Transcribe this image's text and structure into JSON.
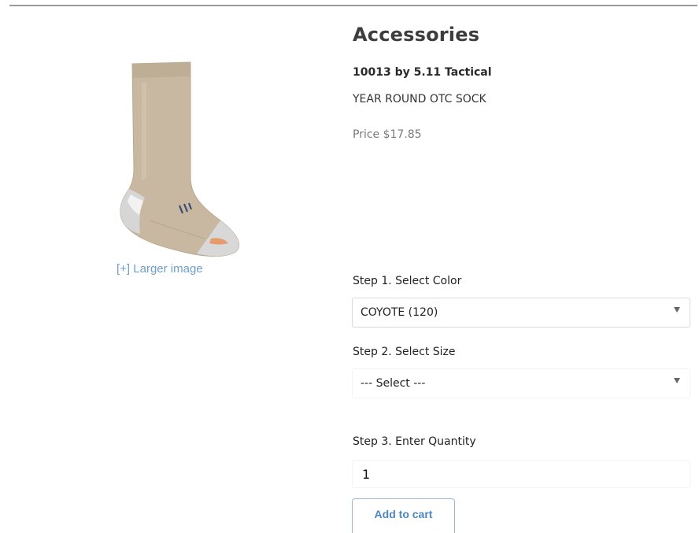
{
  "product": {
    "category_title": "Accessories",
    "brand_line": "10013 by 5.11 Tactical",
    "name": "YEAR ROUND OTC SOCK",
    "price": "Price $17.85",
    "larger_image_link": "[+] Larger image",
    "image_icon": "sock-product-image"
  },
  "options": {
    "step1_label": "Step 1. Select Color",
    "color_selected": "COYOTE (120)",
    "step2_label": "Step 2. Select Size",
    "size_selected": "--- Select ---",
    "step3_label": "Step 3. Enter Quantity",
    "quantity_value": "1"
  },
  "actions": {
    "add_to_cart_label": "Add to cart"
  },
  "colors": {
    "link": "#6f9fc8",
    "button_text": "#4d86bd",
    "sock_main": "#c8b7a0",
    "sock_heel_toe": "#d7d7d7"
  }
}
